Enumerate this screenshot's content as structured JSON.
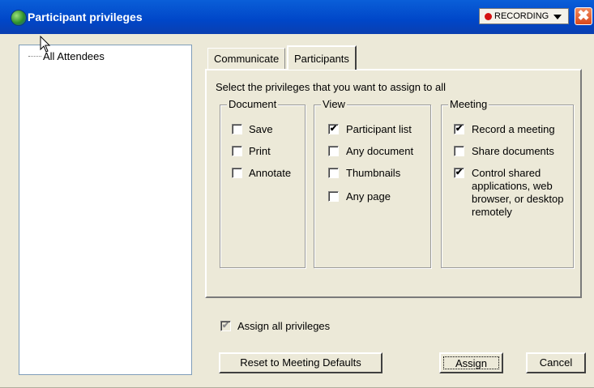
{
  "window": {
    "title": "Participant privileges",
    "recording_label": "RECORDING",
    "close_glyph": "✖"
  },
  "tree": {
    "root_label": "All Attendees"
  },
  "tabs": [
    {
      "label": "Communicate"
    },
    {
      "label": "Participants",
      "selected": true
    }
  ],
  "panel": {
    "instruction": "Select the privileges that you want to assign to all",
    "groups": {
      "document": {
        "title": "Document",
        "items": [
          {
            "label": "Save",
            "checked": false
          },
          {
            "label": "Print",
            "checked": false
          },
          {
            "label": "Annotate",
            "checked": false
          }
        ]
      },
      "view": {
        "title": "View",
        "items": [
          {
            "label": "Participant list",
            "checked": true
          },
          {
            "label": "Any document",
            "checked": false
          },
          {
            "label": "Thumbnails",
            "checked": false
          },
          {
            "label": "Any page",
            "checked": false
          }
        ]
      },
      "meeting": {
        "title": "Meeting",
        "items": [
          {
            "label": "Record a meeting",
            "checked": true
          },
          {
            "label": "Share documents",
            "checked": false
          },
          {
            "label": "Control shared applications, web browser, or desktop remotely",
            "checked": true
          }
        ]
      }
    }
  },
  "assign_all": {
    "label": "Assign all privileges",
    "checked": true,
    "disabled": true
  },
  "buttons": {
    "reset": "Reset to Meeting Defaults",
    "assign": "Assign",
    "cancel": "Cancel"
  },
  "colors": {
    "titlebar": "#0046c8",
    "recording_dot": "#d41212",
    "close": "#d9481c"
  }
}
